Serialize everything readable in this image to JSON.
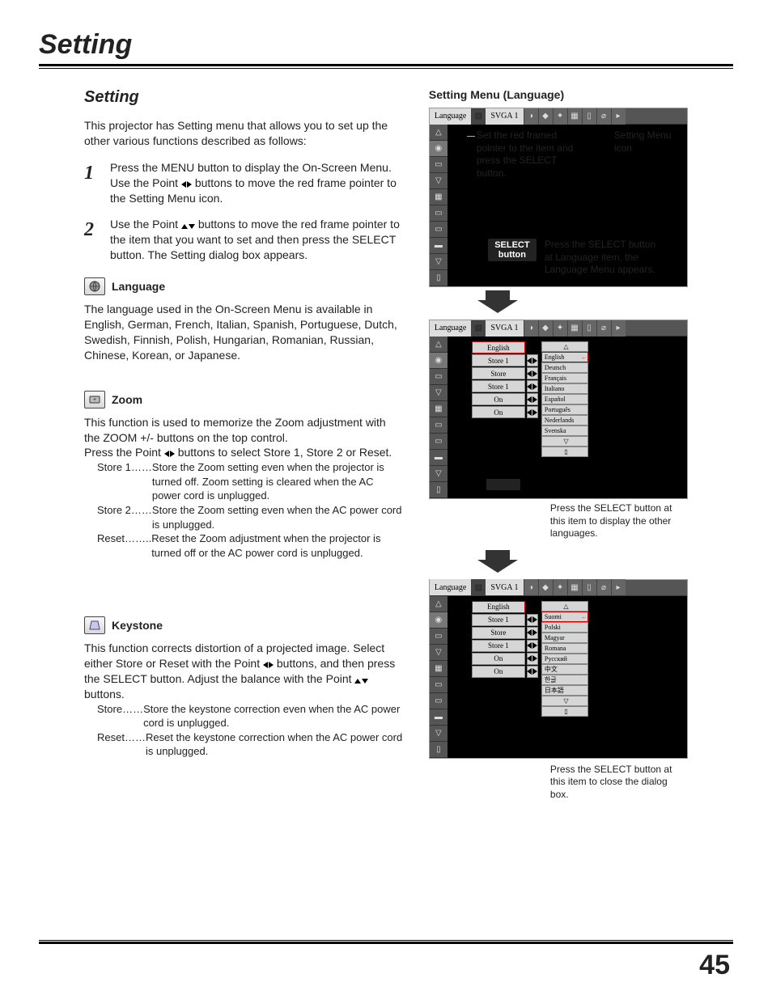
{
  "page": {
    "title": "Setting",
    "section_title": "Setting",
    "number": "45"
  },
  "intro": "This projector has Setting menu that allows you to set up the other various functions described as follows:",
  "steps": {
    "n1": "1",
    "s1a": "Press the MENU button to display the On-Screen Menu. Use the Point ",
    "s1b": " buttons to move the red frame pointer to the Setting Menu icon.",
    "n2": "2",
    "s2a": "Use the Point ",
    "s2b": " buttons to move the red frame pointer to the item that you want to set and then press the SELECT button. The Setting dialog box appears."
  },
  "language": {
    "label": "Language",
    "body": "The language used in the On-Screen Menu is available in English, German, French, Italian, Spanish, Portuguese, Dutch, Swedish, Finnish, Polish, Hungarian, Romanian, Russian, Chinese, Korean, or Japanese."
  },
  "zoom": {
    "label": "Zoom",
    "body1": "This function is used to memorize the Zoom adjustment with the ZOOM +/- buttons on the top control.",
    "body2a": "Press the Point ",
    "body2b": " buttons to select Store 1, Store 2 or Reset.",
    "defs": [
      {
        "k": "Store 1……",
        "v": "Store the Zoom setting even when the projector is turned off. Zoom setting is cleared when the AC power cord is unplugged."
      },
      {
        "k": "Store 2……",
        "v": "Store the Zoom setting even when the AC power cord is unplugged."
      },
      {
        "k": "Reset……..",
        "v": "Reset the Zoom adjustment when the projector is turned off or the AC power cord is unplugged."
      }
    ]
  },
  "keystone": {
    "label": "Keystone",
    "body_a": "This function corrects distortion of a projected image. Select either Store or Reset with the Point ",
    "body_b": " buttons, and then press the SELECT button. Adjust the balance with the Point ",
    "body_c": " buttons.",
    "defs": [
      {
        "k": "Store……",
        "v": "Store the keystone correction even when the AC power cord is unplugged."
      },
      {
        "k": "Reset……",
        "v": "Reset the keystone correction when the AC    power cord is unplugged."
      }
    ]
  },
  "right": {
    "title": "Setting Menu (Language)",
    "top_tab": "Language",
    "svga": "SVGA 1",
    "annot1": "Set the red framed pointer to the item and press the SELECT button.",
    "setting_menu_icon": "Setting Menu icon",
    "annot2": "Press the SELECT button at Language item, the Language Menu appears.",
    "select": "SELECT",
    "button": "button",
    "items": [
      "English",
      "Store 1",
      "Store",
      "Store 1",
      "On",
      "On"
    ],
    "langs1": [
      "English",
      "Deutsch",
      "Français",
      "Italiano",
      "Español",
      "Português",
      "Nederlands",
      "Svenska"
    ],
    "annot3": "Press the SELECT button at this item to display the other languages.",
    "langs2": [
      "Suomi",
      "Polski",
      "Magyar",
      "Romana",
      "Русский",
      "中文",
      "한글",
      "日本語"
    ],
    "annot4": "Press the SELECT button at this item to close the dialog box."
  }
}
